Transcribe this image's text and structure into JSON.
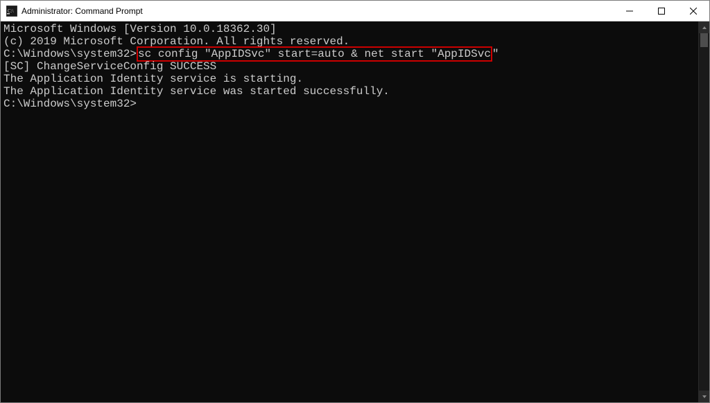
{
  "titlebar": {
    "title": "Administrator: Command Prompt"
  },
  "terminal": {
    "line1": "Microsoft Windows [Version 10.0.18362.30]",
    "line2": "(c) 2019 Microsoft Corporation. All rights reserved.",
    "blank1": "",
    "prompt1_prefix": "C:\\Windows\\system32>",
    "command_highlighted": "sc config \"AppIDSvc\" start=auto & net start \"AppIDSvc",
    "command_tail": "\"",
    "result1": "[SC] ChangeServiceConfig SUCCESS",
    "result2": "The Application Identity service is starting.",
    "result3": "The Application Identity service was started successfully.",
    "blank2": "",
    "blank3": "",
    "prompt2": "C:\\Windows\\system32>"
  }
}
